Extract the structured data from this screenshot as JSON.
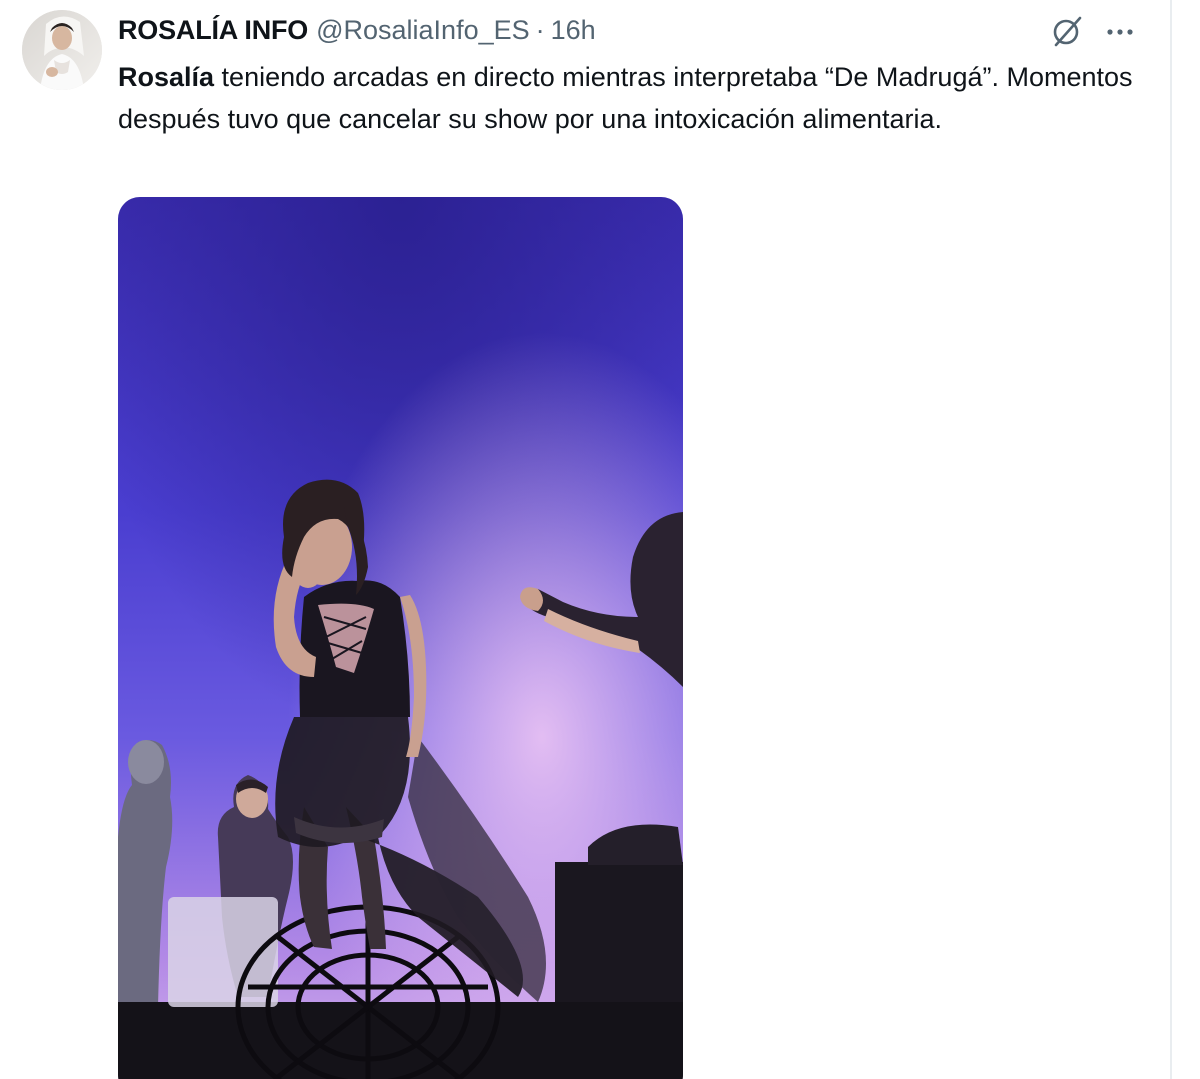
{
  "author": {
    "display_name": "ROSALÍA INFO",
    "handle": "@RosaliaInfo_ES",
    "separator": "·",
    "time": "16h",
    "avatar_icon": "profile-photo"
  },
  "tweet": {
    "mention": "Rosalía",
    "text": " teniendo arcadas en directo mientras interpretaba “De Madrugá”. Momentos después tuvo que cancelar su show por una intoxicación alimentaria."
  },
  "actions": {
    "grok_icon": "grok-icon",
    "more_icon": "more-icon"
  },
  "media": {
    "type": "video-still",
    "description_icon": "concert-photo"
  },
  "colors": {
    "text_primary": "#0f1419",
    "text_secondary": "#536471",
    "divider": "#e9edf0",
    "stage_blue": "#4434c4",
    "stage_purple": "#a06ad8"
  }
}
